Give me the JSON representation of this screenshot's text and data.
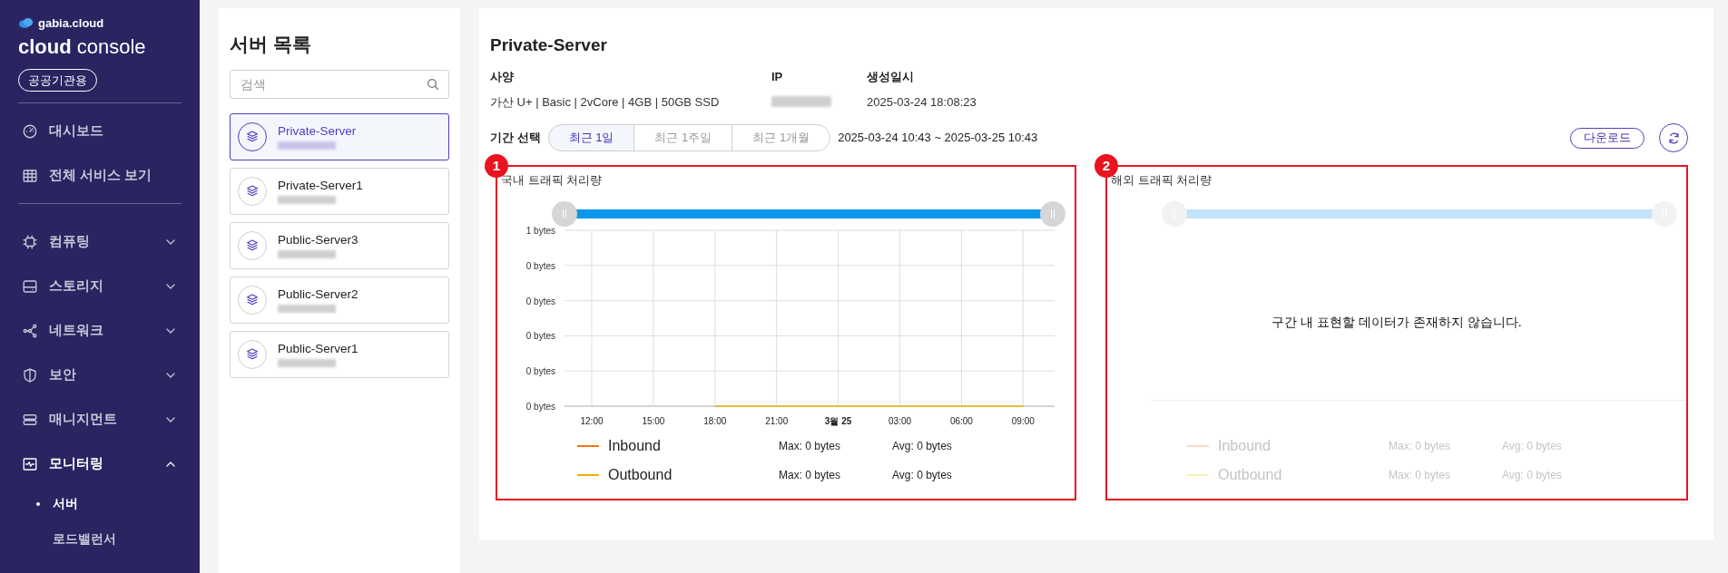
{
  "sidebar": {
    "brand": "gabia.cloud",
    "product_bold": "cloud",
    "product_light": "console",
    "badge": "공공기관용",
    "top_items": [
      {
        "label": "대시보드"
      },
      {
        "label": "전체 서비스 보기"
      }
    ],
    "groups": [
      {
        "label": "컴퓨팅",
        "expanded": false
      },
      {
        "label": "스토리지",
        "expanded": false
      },
      {
        "label": "네트워크",
        "expanded": false
      },
      {
        "label": "보안",
        "expanded": false
      },
      {
        "label": "매니지먼트",
        "expanded": false
      },
      {
        "label": "모니터링",
        "expanded": true,
        "children": [
          {
            "label": "서버",
            "selected": true
          },
          {
            "label": "로드밸런서",
            "selected": false
          }
        ]
      }
    ]
  },
  "server_list": {
    "title": "서버 목록",
    "search": {
      "placeholder": "검색"
    },
    "servers": [
      {
        "name": "Private-Server",
        "selected": true
      },
      {
        "name": "Private-Server1",
        "selected": false
      },
      {
        "name": "Public-Server3",
        "selected": false
      },
      {
        "name": "Public-Server2",
        "selected": false
      },
      {
        "name": "Public-Server1",
        "selected": false
      }
    ]
  },
  "detail": {
    "title": "Private-Server",
    "specs": [
      {
        "label": "사양",
        "value": "가산 U+ | Basic | 2vCore | 4GB | 50GB SSD",
        "blurred": false
      },
      {
        "label": "IP",
        "blurred": true
      },
      {
        "label": "생성일시",
        "value": "2025-03-24 18:08:23",
        "blurred": false
      }
    ],
    "period_label": "기간 선택",
    "periods": [
      {
        "label": "최근 1일",
        "selected": true
      },
      {
        "label": "최근 1주일",
        "selected": false
      },
      {
        "label": "최근 1개월",
        "selected": false
      }
    ],
    "range": "2025-03-24 10:43 ~ 2025-03-25 10:43",
    "download": "다운로드",
    "charts": [
      {
        "marker": "1",
        "title": "국내 트래픽 처리량",
        "has_data": true,
        "y_gridline_labels": [
          "0 bytes",
          "0 bytes",
          "0 bytes",
          "0 bytes"
        ],
        "chart_data": {
          "type": "line",
          "grid": true,
          "x": [
            "12:00",
            "15:00",
            "18:00",
            "21:00",
            "3월 25",
            "03:00",
            "06:00",
            "09:00"
          ],
          "ylim": [
            0,
            1
          ],
          "yticks": [
            {
              "value": 1,
              "label": "1 bytes"
            },
            {
              "value": 0,
              "label": "0 bytes"
            }
          ],
          "series": [
            {
              "name": "Inbound",
              "color": "#f97316",
              "values": [
                null,
                null,
                null,
                null,
                null,
                null,
                null,
                null
              ]
            },
            {
              "name": "Outbound",
              "color": "#eab308",
              "values": [
                null,
                null,
                0,
                0,
                0,
                0,
                0,
                0
              ]
            }
          ]
        },
        "legend": [
          {
            "max": "Max: 0 bytes",
            "avg": "Avg: 0 bytes"
          },
          {
            "max": "Max: 0 bytes",
            "avg": "Avg: 0 bytes"
          }
        ]
      },
      {
        "marker": "2",
        "title": "해외 트래픽 처리량",
        "has_data": false,
        "empty_message": "구간 내 표현할 데이터가 존재하지 않습니다.",
        "legend": [
          {
            "name": "Inbound",
            "color": "#fbd9c4",
            "max": "Max: 0 bytes",
            "avg": "Avg: 0 bytes"
          },
          {
            "name": "Outbound",
            "color": "#fbf0b8",
            "max": "Max: 0 bytes",
            "avg": "Avg: 0 bytes"
          }
        ]
      }
    ]
  }
}
